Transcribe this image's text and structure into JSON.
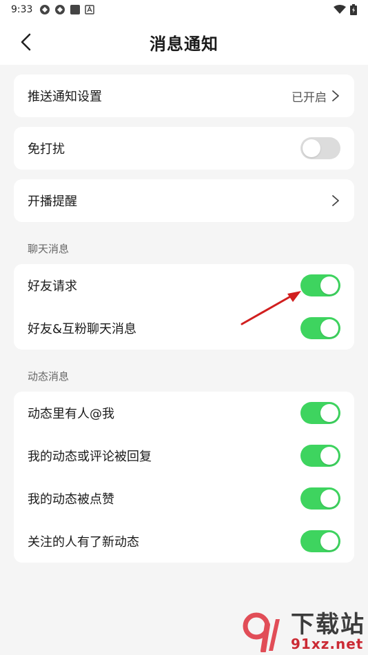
{
  "status_bar": {
    "time": "9:33",
    "left_icons": [
      "app-icon-1",
      "app-icon-2",
      "square-icon",
      "a-badge-icon"
    ],
    "right_icons": [
      "wifi-icon",
      "battery-icon"
    ]
  },
  "header": {
    "title": "消息通知",
    "back_icon": "chevron-left-icon"
  },
  "groups": {
    "push": {
      "label": "推送通知设置",
      "value": "已开启"
    },
    "dnd": {
      "label": "免打扰",
      "on": false
    },
    "live": {
      "label": "开播提醒"
    }
  },
  "chat": {
    "title": "聊天消息",
    "items": [
      {
        "label": "好友请求",
        "on": true
      },
      {
        "label": "好友&互粉聊天消息",
        "on": true
      }
    ]
  },
  "feed": {
    "title": "动态消息",
    "items": [
      {
        "label": "动态里有人@我",
        "on": true
      },
      {
        "label": "我的动态或评论被回复",
        "on": true
      },
      {
        "label": "我的动态被点赞",
        "on": true
      },
      {
        "label": "关注的人有了新动态",
        "on": true
      }
    ]
  },
  "watermark": {
    "cn": "下载站",
    "url": "91xz.net"
  },
  "colors": {
    "toggle_on": "#3ed45f",
    "toggle_off": "#dcdcdc",
    "annotation_arrow": "#d11f1f"
  }
}
